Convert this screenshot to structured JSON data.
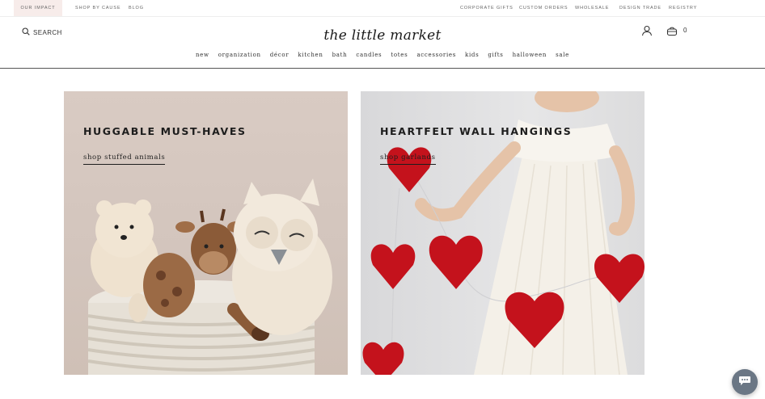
{
  "topbar": {
    "impact": "OUR IMPACT",
    "shop_by_cause": "SHOP BY CAUSE",
    "blog": "BLOG",
    "corporate_gifts": "CORPORATE GIFTS",
    "custom_orders": "CUSTOM ORDERS",
    "wholesale": "WHOLESALE",
    "design_trade": "DESIGN TRADE",
    "registry": "REGISTRY"
  },
  "header": {
    "search_label": "SEARCH",
    "logo": "the little market",
    "cart_count": "0"
  },
  "nav": {
    "items": [
      "new",
      "organization",
      "décor",
      "kitchen",
      "bath",
      "candles",
      "totes",
      "accessories",
      "kids",
      "gifts",
      "halloween",
      "sale"
    ]
  },
  "promos": [
    {
      "heading": "HUGGABLE MUST-HAVES",
      "link": "shop stuffed animals"
    },
    {
      "heading": "HEARTFELT WALL HANGINGS",
      "link": "shop garlands"
    }
  ],
  "colors": {
    "impact_bg": "#f7ecea",
    "heart_red": "#c4121c",
    "chat_bubble": "#6b7785"
  }
}
